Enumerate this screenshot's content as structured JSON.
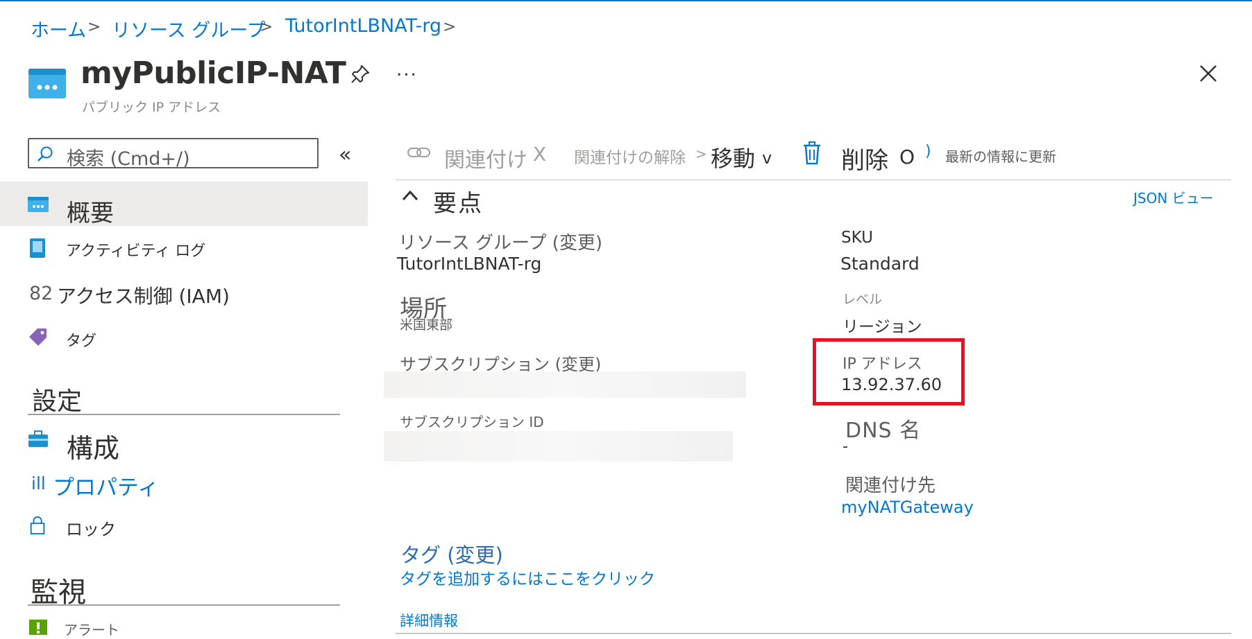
{
  "breadcrumb": {
    "items": [
      {
        "label": "ホーム"
      },
      {
        "label": "リソース グループ"
      },
      {
        "label": "TutorIntLBNAT-rg"
      }
    ],
    "separator": ">"
  },
  "header": {
    "title": "myPublicIP-NAT",
    "subtitle": "パブリック IP アドレス",
    "more_label": "..."
  },
  "search": {
    "placeholder": "検索 (Cmd+/)",
    "collapse_label": "«"
  },
  "sidebar": {
    "items": [
      {
        "label": "概要",
        "icon": "public-ip-icon",
        "selected": true
      },
      {
        "label": "アクティビティ ログ",
        "icon": "activity-log-icon"
      },
      {
        "label": "アクセス制御 (IAM)",
        "prefix": "82",
        "icon": "iam-icon"
      },
      {
        "label": "タグ",
        "icon": "tag-icon"
      }
    ],
    "sections": [
      {
        "title": "設定",
        "items": [
          {
            "label": "構成",
            "icon": "configuration-icon"
          },
          {
            "label": "プロパティ",
            "prefix": "ill",
            "icon": "properties-icon"
          },
          {
            "label": "ロック",
            "icon": "lock-icon"
          }
        ]
      },
      {
        "title": "監視",
        "items": [
          {
            "label": "アラート",
            "icon": "alert-icon"
          }
        ]
      }
    ]
  },
  "toolbar": {
    "associate_label": "関連付け",
    "associate_suffix": "X",
    "dissociate_label": "関連付けの解除",
    "dissociate_suffix": ">",
    "move_label": "移動",
    "move_suffix": "v",
    "delete_label": "削除",
    "delete_suffix": "O",
    "refresh_prefix": ")",
    "refresh_label": "最新の情報に更新"
  },
  "essentials": {
    "title": "要点",
    "json_view_label": "JSON ビュー",
    "left": {
      "resource_group_label": "リソース グループ (変更)",
      "resource_group_value": "TutorIntLBNAT-rg",
      "location_label": "場所",
      "location_value": "米国東部",
      "subscription_label": "サブスクリプション (変更)",
      "subscription_id_label": "サブスクリプション ID"
    },
    "right": {
      "sku_label": "SKU",
      "sku_value": "Standard",
      "tier_label": "レベル",
      "tier_value": "リージョン",
      "ip_label": "IP アドレス",
      "ip_value": "13.92.37.60",
      "dns_label": "DNS 名",
      "dns_value": "-",
      "associated_label": "関連付け先",
      "associated_value": "myNATGateway"
    },
    "tags_label": "タグ (変更)",
    "tags_add_link": "タグを追加するにはここをクリック",
    "more_info_link": "詳細情報"
  },
  "colors": {
    "accent": "#0078d4",
    "highlight": "#e81123",
    "selected_bg": "#edebe9"
  }
}
